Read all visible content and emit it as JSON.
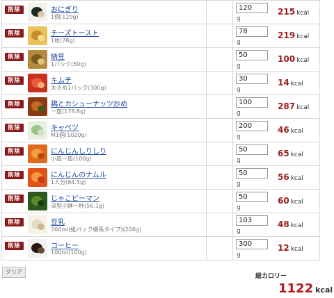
{
  "delete_label": "削除",
  "unit_g": "g",
  "kcal_unit": "kcal",
  "clear_label": "クリア",
  "total": {
    "label": "総カロリー",
    "value": "1122",
    "unit": "kcal"
  },
  "items": [
    {
      "name": "おにぎり",
      "portion": "1個(120g)",
      "qty": "120",
      "kcal": "215",
      "thumb": [
        "#f4f1ea",
        "#1f2a22",
        "#d9c9a8"
      ]
    },
    {
      "name": "チーズトースト",
      "portion": "1枚(78g)",
      "qty": "78",
      "kcal": "219",
      "thumb": [
        "#e8c35a",
        "#c98a30",
        "#f5df8c"
      ]
    },
    {
      "name": "納豆",
      "portion": "1パック(50g)",
      "qty": "50",
      "kcal": "100",
      "thumb": [
        "#b48a3c",
        "#7a5a1e",
        "#e0c27a"
      ]
    },
    {
      "name": "キムチ",
      "portion": "大きめ1パック(300g)",
      "qty": "30",
      "kcal": "14",
      "thumb": [
        "#c9311e",
        "#e85a3a",
        "#f2b07a"
      ]
    },
    {
      "name": "鶏とカシューナッツ炒め",
      "portion": "一皿(178.8g)",
      "qty": "100",
      "kcal": "287",
      "thumb": [
        "#8a3a12",
        "#c46a24",
        "#3e5a1e"
      ]
    },
    {
      "name": "キャベツ",
      "portion": "M1個(1020g)",
      "qty": "200",
      "kcal": "46",
      "thumb": [
        "#e8f0de",
        "#9dc48a",
        "#cfe3bf"
      ]
    },
    {
      "name": "にんじんしりしり",
      "portion": "小皿一皿(100g)",
      "qty": "50",
      "kcal": "65",
      "thumb": [
        "#e06a1c",
        "#f0a040",
        "#b84a10"
      ]
    },
    {
      "name": "にんじんのナムル",
      "portion": "1人分(84.5g)",
      "qty": "50",
      "kcal": "56",
      "thumb": [
        "#e0541a",
        "#f39a3c",
        "#c43a10"
      ]
    },
    {
      "name": "じゃこピーマン",
      "portion": "深型小鉢一杯(56.1g)",
      "qty": "50",
      "kcal": "60",
      "thumb": [
        "#2d5a1e",
        "#5a8a2a",
        "#1e3a14"
      ]
    },
    {
      "name": "豆乳",
      "portion": "200ml(紙パック細長タイプ)(206g)",
      "qty": "103",
      "kcal": "48",
      "thumb": [
        "#f6f2e6",
        "#e6dcc4",
        "#c8b890"
      ]
    },
    {
      "name": "コーヒー",
      "portion": "100ml(100g)",
      "qty": "300",
      "kcal": "12",
      "thumb": [
        "#f2f2f2",
        "#2a1810",
        "#6a4a30"
      ]
    }
  ]
}
